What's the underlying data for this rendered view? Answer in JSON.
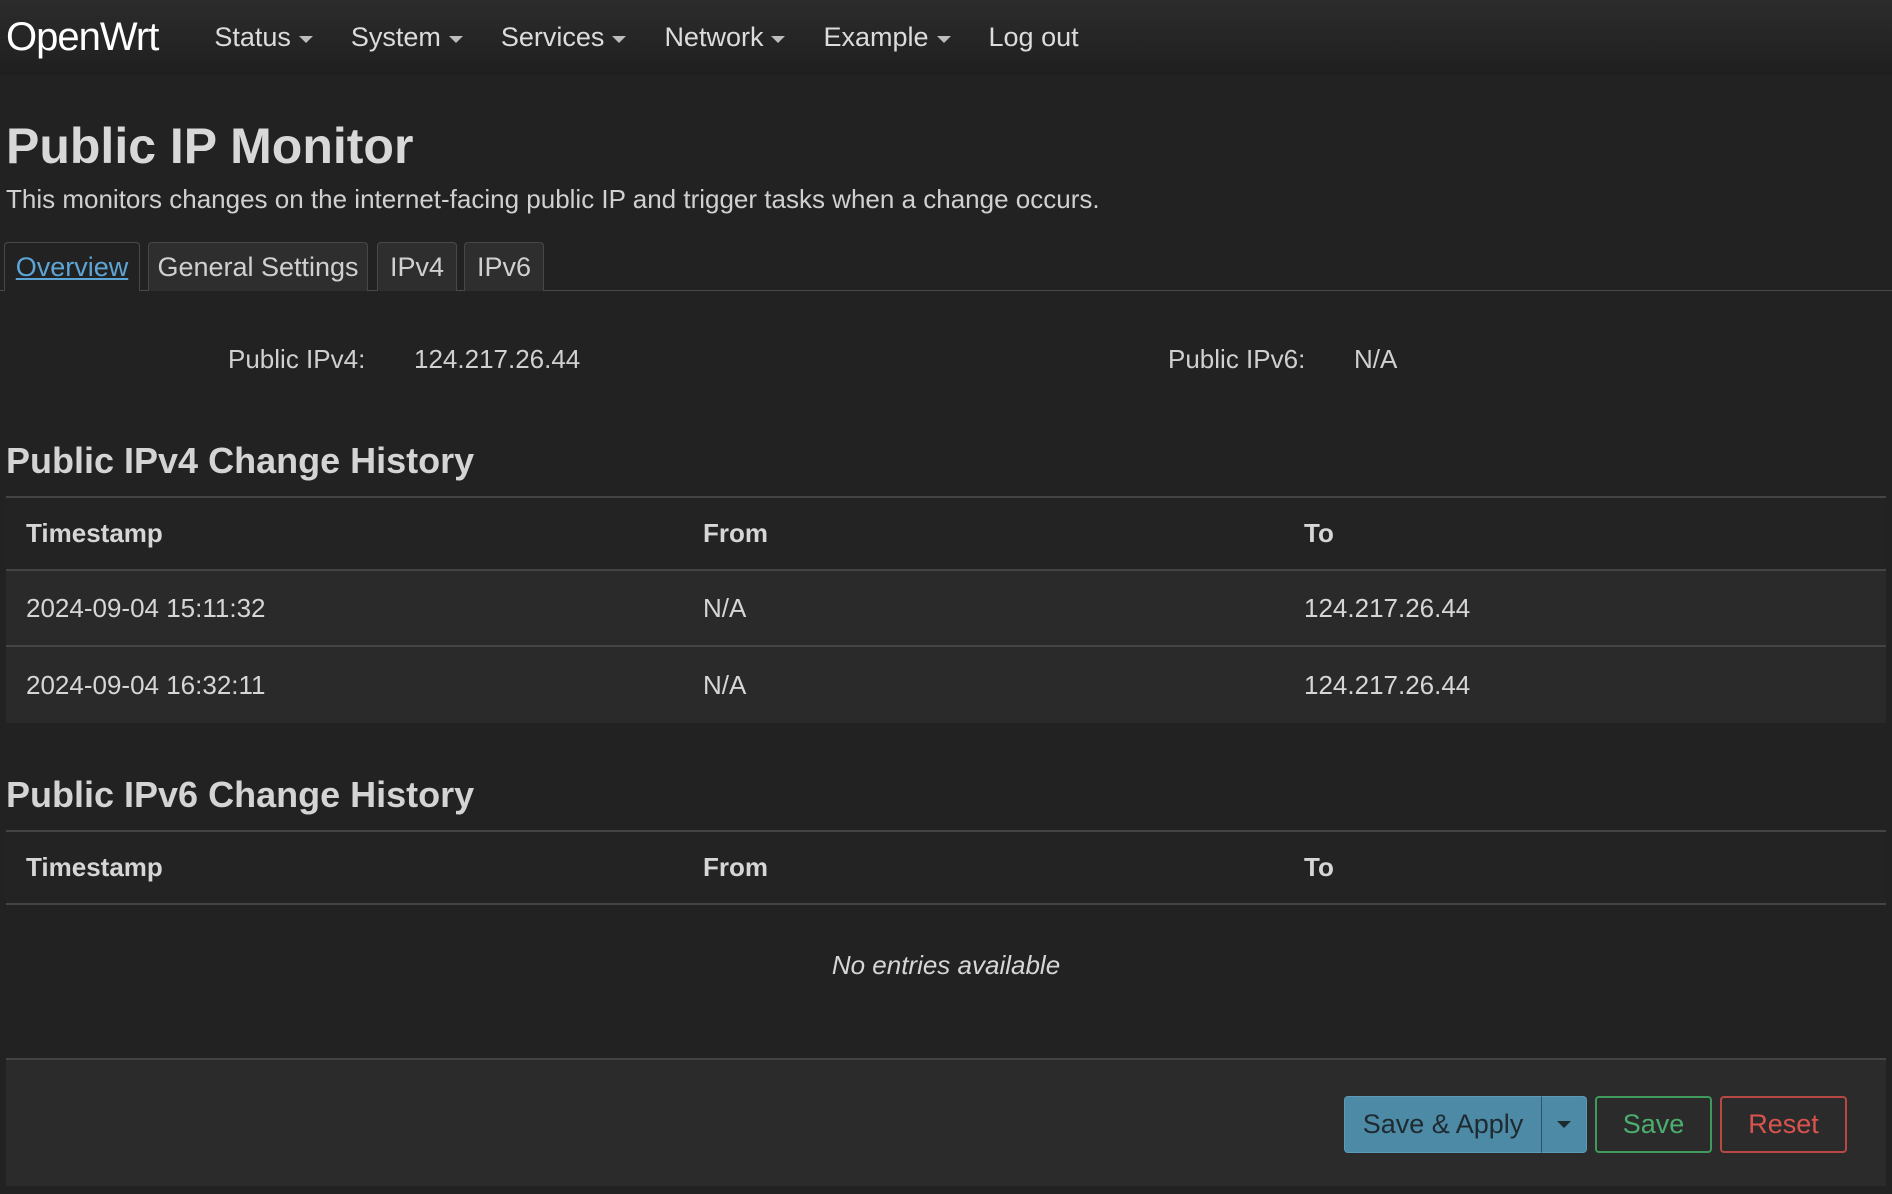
{
  "navbar": {
    "brand": "OpenWrt",
    "items": [
      {
        "label": "Status",
        "dropdown": true
      },
      {
        "label": "System",
        "dropdown": true
      },
      {
        "label": "Services",
        "dropdown": true
      },
      {
        "label": "Network",
        "dropdown": true
      },
      {
        "label": "Example",
        "dropdown": true
      },
      {
        "label": "Log out",
        "dropdown": false
      }
    ]
  },
  "page": {
    "title": "Public IP Monitor",
    "description": "This monitors changes on the internet-facing public IP and trigger tasks when a change occurs."
  },
  "tabs": [
    {
      "label": "Overview",
      "active": true
    },
    {
      "label": "General Settings",
      "active": false
    },
    {
      "label": "IPv4",
      "active": false
    },
    {
      "label": "IPv6",
      "active": false
    }
  ],
  "overview": {
    "ipv4_label": "Public IPv4:",
    "ipv4_value": "124.217.26.44",
    "ipv6_label": "Public IPv6:",
    "ipv6_value": "N/A"
  },
  "ipv4_history": {
    "title": "Public IPv4 Change History",
    "columns": [
      "Timestamp",
      "From",
      "To"
    ],
    "rows": [
      [
        "2024-09-04 15:11:32",
        "N/A",
        "124.217.26.44"
      ],
      [
        "2024-09-04 16:32:11",
        "N/A",
        "124.217.26.44"
      ]
    ]
  },
  "ipv6_history": {
    "title": "Public IPv6 Change History",
    "columns": [
      "Timestamp",
      "From",
      "To"
    ],
    "empty_text": "No entries available"
  },
  "actions": {
    "save_apply_label": "Save & Apply",
    "save_label": "Save",
    "reset_label": "Reset"
  },
  "colors": {
    "background": "#222222",
    "accent_link": "#5ca6d6",
    "apply_button": "#4c8aa6",
    "save_green": "#4cae6e",
    "reset_red": "#d9534f"
  }
}
